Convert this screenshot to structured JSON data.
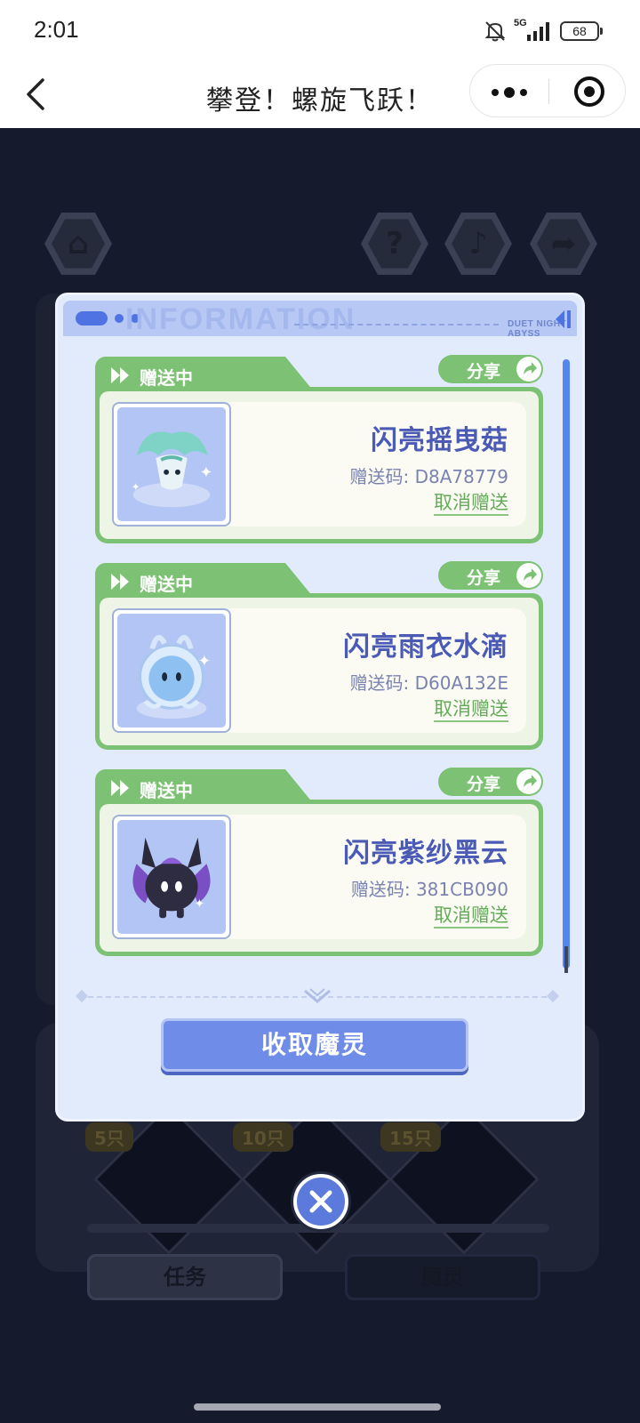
{
  "status_bar": {
    "time": "2:01",
    "network": "5G",
    "battery": "68"
  },
  "nav": {
    "title": "攀登！螺旋飞跃！"
  },
  "modal": {
    "header_watermark": "INFORMATION",
    "header_brand": "DUET NIGHT ABYSS",
    "gifts": [
      {
        "status": "赠送中",
        "share_label": "分享",
        "name": "闪亮摇曳菇",
        "code": "赠送码: D8A78779",
        "cancel_label": "取消赠送",
        "pet_icon": "mushroom-pet-icon"
      },
      {
        "status": "赠送中",
        "share_label": "分享",
        "name": "闪亮雨衣水滴",
        "code": "赠送码: D60A132E",
        "cancel_label": "取消赠送",
        "pet_icon": "water-drop-pet-icon"
      },
      {
        "status": "赠送中",
        "share_label": "分享",
        "name": "闪亮紫纱黑云",
        "code": "赠送码: 381CB090",
        "cancel_label": "取消赠送",
        "pet_icon": "dark-cloud-pet-icon"
      }
    ],
    "collect_button": "收取魔灵"
  },
  "background": {
    "rewards": [
      {
        "label": "5只"
      },
      {
        "label": "10只"
      },
      {
        "label": "15只"
      }
    ],
    "tabs": [
      {
        "label": "任务"
      },
      {
        "label": "魔灵"
      }
    ]
  },
  "colors": {
    "accent_green": "#7dc274",
    "accent_blue": "#6e8ce8",
    "name_text": "#4a5ab5"
  }
}
